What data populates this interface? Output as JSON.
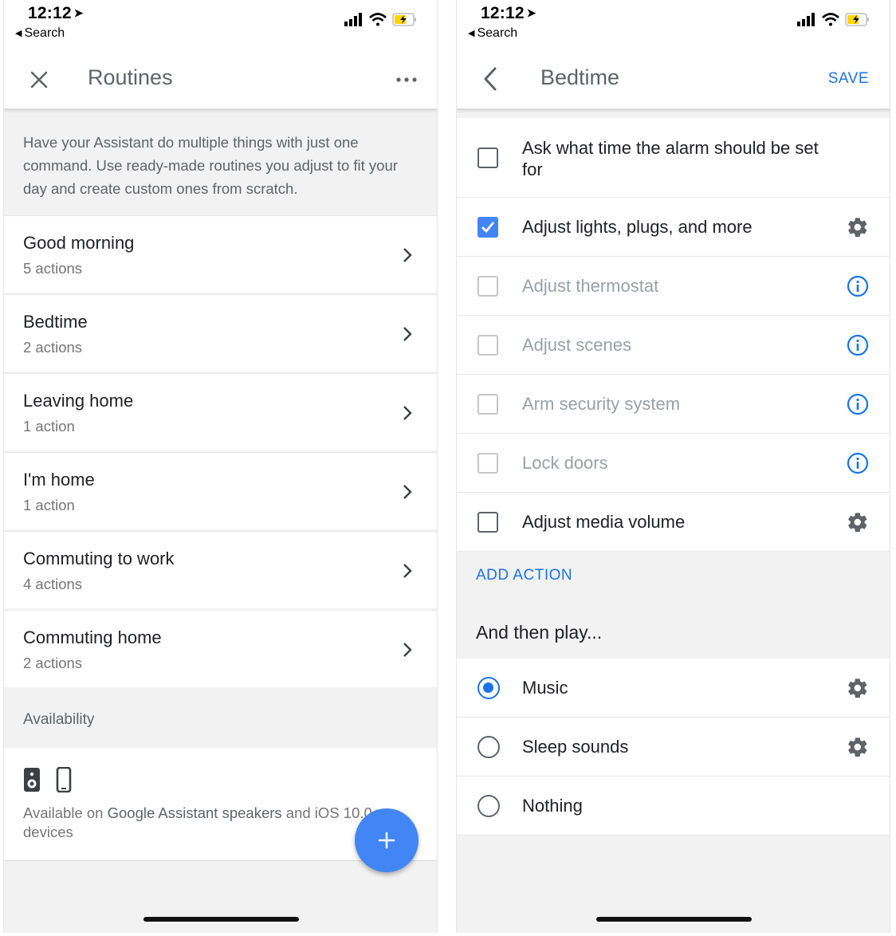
{
  "left": {
    "status": {
      "time": "12:12",
      "back_label": "Search"
    },
    "appbar": {
      "title": "Routines"
    },
    "intro": "Have your Assistant do multiple things with just one command. Use ready-made routines you adjust to fit your day and create custom ones from scratch.",
    "routines": [
      {
        "name": "Good morning",
        "count": "5 actions"
      },
      {
        "name": "Bedtime",
        "count": "2 actions"
      },
      {
        "name": "Leaving home",
        "count": "1 action"
      },
      {
        "name": "I'm home",
        "count": "1 action"
      },
      {
        "name": "Commuting to work",
        "count": "4 actions"
      },
      {
        "name": "Commuting home",
        "count": "2 actions"
      }
    ],
    "availability": {
      "heading": "Availability",
      "prefix": "Available on ",
      "highlight": "Google Assistant speakers",
      "suffix": " and iOS 10.0+ devices"
    }
  },
  "right": {
    "status": {
      "time": "12:12",
      "back_label": "Search"
    },
    "appbar": {
      "title": "Bedtime",
      "save_label": "SAVE"
    },
    "actions": [
      {
        "label": "Ask what time the alarm should be set for",
        "checked": false,
        "enabled": true,
        "icon": "none"
      },
      {
        "label": "Adjust lights, plugs, and more",
        "checked": true,
        "enabled": true,
        "icon": "gear-icon"
      },
      {
        "label": "Adjust thermostat",
        "checked": false,
        "enabled": false,
        "icon": "info-icon"
      },
      {
        "label": "Adjust scenes",
        "checked": false,
        "enabled": false,
        "icon": "info-icon"
      },
      {
        "label": "Arm security system",
        "checked": false,
        "enabled": false,
        "icon": "info-icon"
      },
      {
        "label": "Lock doors",
        "checked": false,
        "enabled": false,
        "icon": "info-icon"
      },
      {
        "label": "Adjust media volume",
        "checked": false,
        "enabled": true,
        "icon": "gear-icon"
      }
    ],
    "add_action_label": "ADD ACTION",
    "then_play_label": "And then play...",
    "play_options": [
      {
        "label": "Music",
        "selected": true,
        "icon": "gear-icon"
      },
      {
        "label": "Sleep sounds",
        "selected": false,
        "icon": "gear-icon"
      },
      {
        "label": "Nothing",
        "selected": false,
        "icon": "none"
      }
    ]
  },
  "colors": {
    "accent": "#4285f4",
    "link": "#1a73e8",
    "disabled_text": "#9aa0a6",
    "background": "#f2f2f2"
  }
}
